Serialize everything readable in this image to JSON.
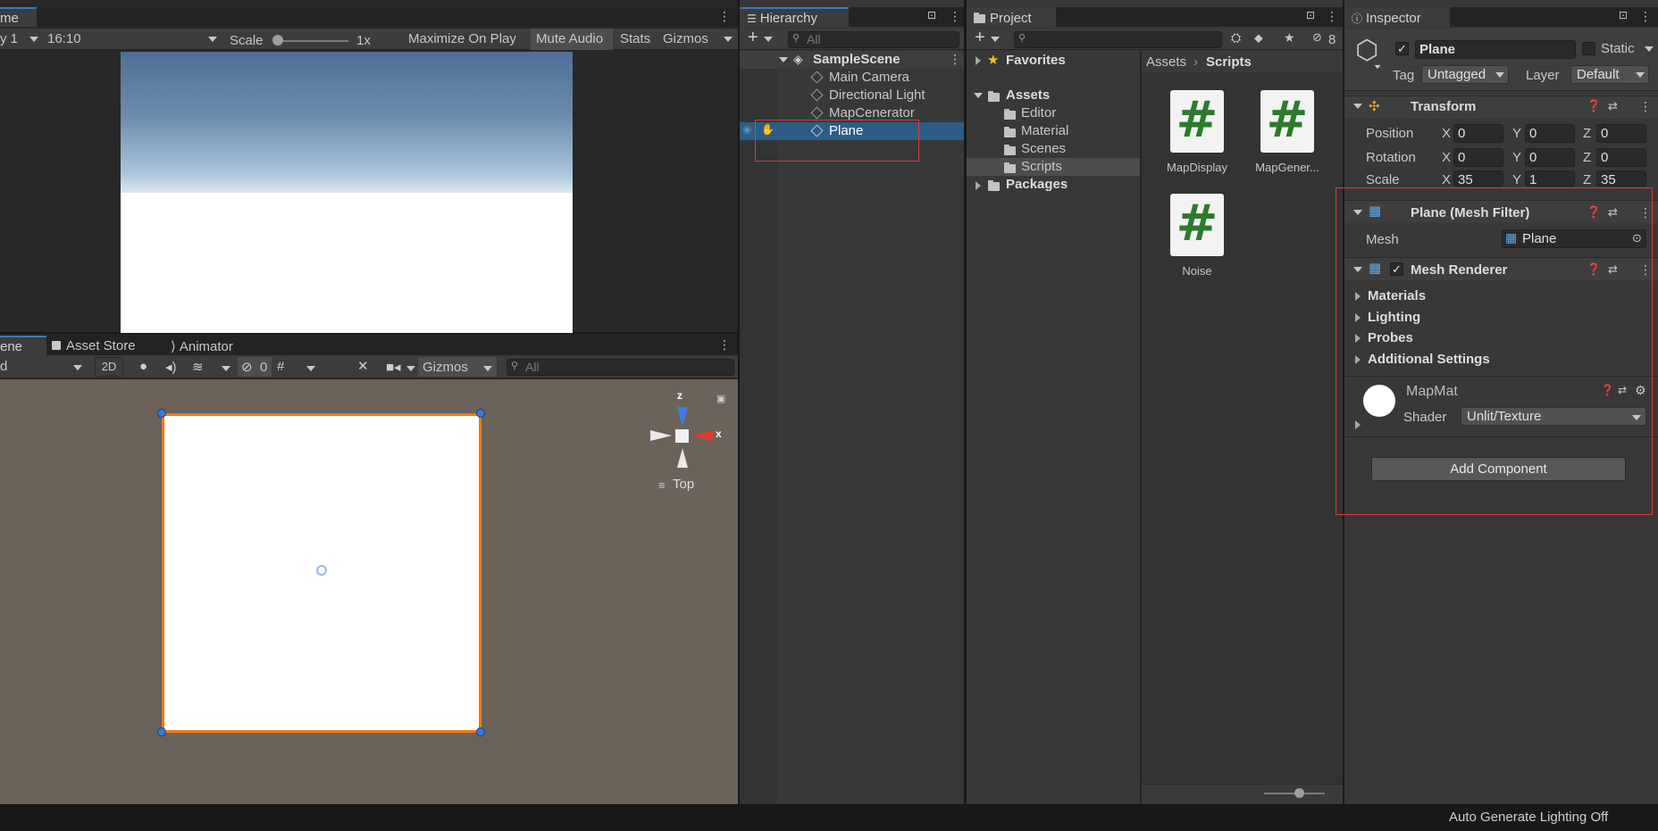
{
  "game": {
    "tab": "me",
    "display": "y 1",
    "aspect": "16:10",
    "scale_label": "Scale",
    "scale_value": "1x",
    "maximize": "Maximize On Play",
    "mute": "Mute Audio",
    "stats": "Stats",
    "gizmos": "Gizmos"
  },
  "scene": {
    "tab_scene": "ene",
    "tab_asset_store": "Asset Store",
    "tab_animator": "Animator",
    "shading": "d",
    "mode_2d": "2D",
    "hidden_count": "0",
    "gizmos": "Gizmos",
    "search_placeholder": "All",
    "gizmo_z": "z",
    "gizmo_x": "x",
    "view_label": "Top"
  },
  "hierarchy": {
    "tab": "Hierarchy",
    "search_placeholder": "All",
    "scene_name": "SampleScene",
    "items": [
      {
        "label": "Main Camera"
      },
      {
        "label": "Directional Light"
      },
      {
        "label": "MapCenerator"
      },
      {
        "label": "Plane",
        "selected": true
      }
    ]
  },
  "project": {
    "tab": "Project",
    "hidden_count": "8",
    "favorites": "Favorites",
    "assets": "Assets",
    "folders": [
      "Editor",
      "Material",
      "Scenes",
      "Scripts"
    ],
    "packages": "Packages",
    "breadcrumb_root": "Assets",
    "breadcrumb_current": "Scripts",
    "files": [
      "MapDisplay",
      "MapGener...",
      "Noise"
    ]
  },
  "inspector": {
    "tab": "Inspector",
    "object_name": "Plane",
    "static_label": "Static",
    "tag_label": "Tag",
    "tag_value": "Untagged",
    "layer_label": "Layer",
    "layer_value": "Default",
    "transform": {
      "title": "Transform",
      "position_label": "Position",
      "rotation_label": "Rotation",
      "scale_label": "Scale",
      "axis_x": "X",
      "axis_y": "Y",
      "axis_z": "Z",
      "position": [
        "0",
        "0",
        "0"
      ],
      "rotation": [
        "0",
        "0",
        "0"
      ],
      "scale": [
        "35",
        "1",
        "35"
      ]
    },
    "mesh_filter": {
      "title": "Plane (Mesh Filter)",
      "mesh_label": "Mesh",
      "mesh_value": "Plane"
    },
    "mesh_renderer": {
      "title": "Mesh Renderer",
      "sections": [
        "Materials",
        "Lighting",
        "Probes",
        "Additional Settings"
      ]
    },
    "material": {
      "name": "MapMat",
      "shader_label": "Shader",
      "shader_value": "Unlit/Texture"
    },
    "add_component": "Add Component"
  },
  "status": {
    "text": "Auto Generate Lighting Off"
  },
  "colors": {
    "selection": "#2c5d87",
    "accent_blue": "#3a79bb",
    "highlight_red": "#e03a3a",
    "scene_bg": "#6b625a",
    "plane_outline": "#f07a1a",
    "script_green": "#2d7a2d"
  }
}
